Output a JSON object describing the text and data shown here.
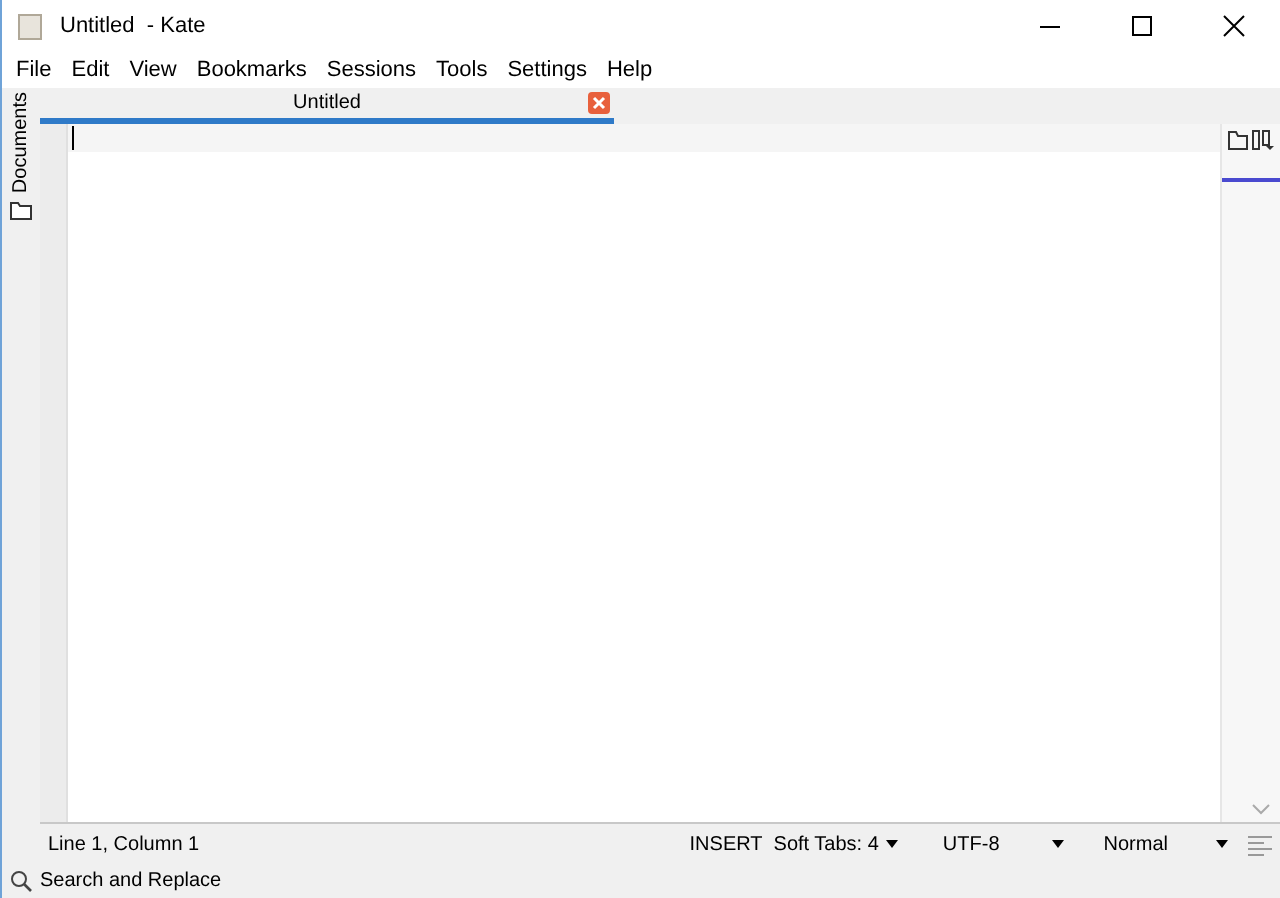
{
  "window": {
    "title": "Untitled  - Kate"
  },
  "menu": [
    "File",
    "Edit",
    "View",
    "Bookmarks",
    "Sessions",
    "Tools",
    "Settings",
    "Help"
  ],
  "side_panel": {
    "label": "Documents"
  },
  "tabs": [
    {
      "label": "Untitled",
      "selected": true
    }
  ],
  "status_bar": {
    "position": "Line 1, Column 1",
    "mode": "INSERT",
    "indent": "Soft Tabs: 4",
    "encoding": "UTF-8",
    "highlighting": "Normal"
  },
  "bottom_bar": {
    "search": "Search and Replace"
  }
}
